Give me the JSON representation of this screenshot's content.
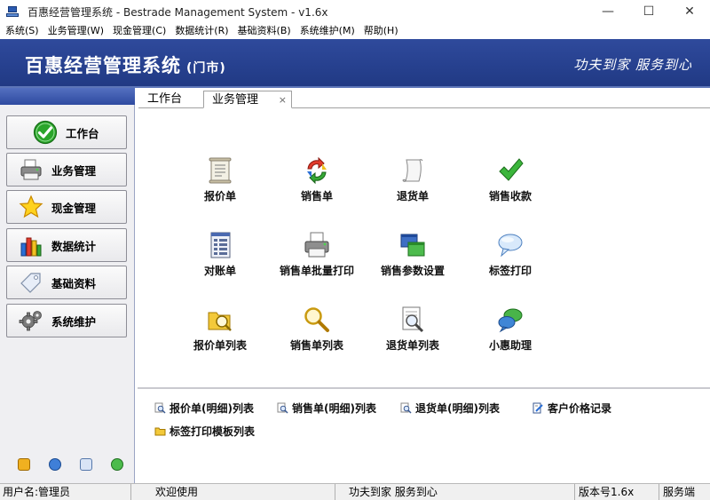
{
  "window": {
    "title": "百惠经营管理系统 - Bestrade Management System - v1.6x",
    "controls": {
      "minimize": "—",
      "maximize": "☐",
      "close": "✕"
    }
  },
  "menu": [
    {
      "label": "系统(S)"
    },
    {
      "label": "业务管理(W)"
    },
    {
      "label": "现金管理(C)"
    },
    {
      "label": "数据统计(R)"
    },
    {
      "label": "基础资料(B)"
    },
    {
      "label": "系统维护(M)"
    },
    {
      "label": "帮助(H)"
    }
  ],
  "banner": {
    "title": "百惠经营管理系统",
    "subtitle": "(门市)",
    "slogan": "功夫到家  服务到心"
  },
  "sidebar": {
    "items": [
      {
        "label": "工作台",
        "icon": "check-circle-icon"
      },
      {
        "label": "业务管理",
        "icon": "printer-icon"
      },
      {
        "label": "现金管理",
        "icon": "star-icon"
      },
      {
        "label": "数据统计",
        "icon": "bar-chart-icon"
      },
      {
        "label": "基础资料",
        "icon": "tag-icon"
      },
      {
        "label": "系统维护",
        "icon": "gear-icon"
      }
    ],
    "tools": [
      "key-icon",
      "clock-icon",
      "search-window-icon",
      "globe-icon"
    ]
  },
  "tabs": [
    {
      "label": "工作台"
    },
    {
      "label": "业务管理",
      "close": "×"
    }
  ],
  "functions": [
    {
      "label": "报价单",
      "icon": "document-icon"
    },
    {
      "label": "销售单",
      "icon": "recycle-arrows-icon"
    },
    {
      "label": "退货单",
      "icon": "return-paper-icon"
    },
    {
      "label": "销售收款",
      "icon": "green-check-icon"
    },
    {
      "label": "对账单",
      "icon": "ledger-icon"
    },
    {
      "label": "销售单批量打印",
      "icon": "printer-icon"
    },
    {
      "label": "销售参数设置",
      "icon": "window-settings-icon"
    },
    {
      "label": "标签打印",
      "icon": "speech-bubble-icon"
    },
    {
      "label": "报价单列表",
      "icon": "folder-search-icon"
    },
    {
      "label": "销售单列表",
      "icon": "magnifier-icon"
    },
    {
      "label": "退货单列表",
      "icon": "page-search-icon"
    },
    {
      "label": "小惠助理",
      "icon": "chat-bubbles-icon"
    }
  ],
  "links": [
    {
      "label": "报价单(明细)列表",
      "icon": "search-doc-icon"
    },
    {
      "label": "销售单(明细)列表",
      "icon": "search-doc-icon"
    },
    {
      "label": "退货单(明细)列表",
      "icon": "search-doc-icon"
    },
    {
      "label": "客户价格记录",
      "icon": "edit-doc-icon"
    },
    {
      "label": "标签打印模板列表",
      "icon": "folder-icon"
    }
  ],
  "status": {
    "user": "用户名:管理员",
    "welcome": "欢迎使用",
    "slogan": "功夫到家 服务到心",
    "version": "版本号1.6x",
    "mode": "服务端"
  },
  "colors": {
    "banner": "#26408e",
    "sidebar_head": "#2e4aa0",
    "sidebar_bg": "#efeff2"
  }
}
